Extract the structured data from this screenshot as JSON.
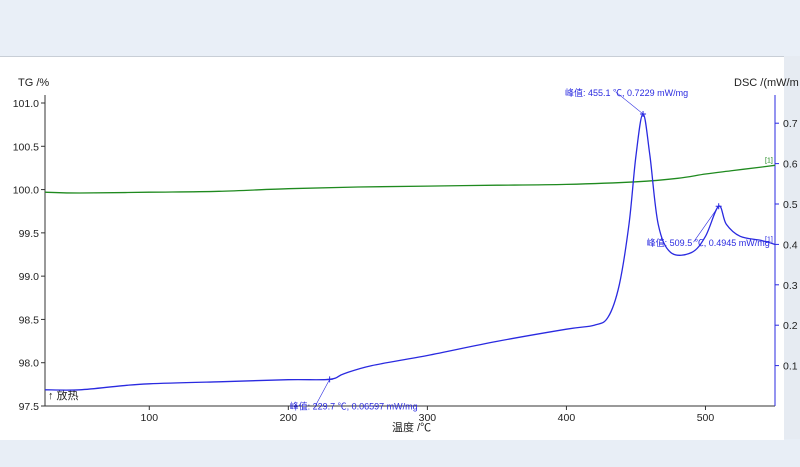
{
  "chart_data": {
    "type": "line",
    "y_left_label": "TG /%",
    "y_right_label": "DSC /(mW/m",
    "xlabel": "温度 /℃",
    "xlim": [
      25,
      550
    ],
    "x_ticks": [
      100,
      200,
      300,
      400,
      500
    ],
    "y_left_lim": [
      97.5,
      101.0
    ],
    "y_left_ticks": [
      "97.5",
      "98.0",
      "98.5",
      "99.0",
      "99.5",
      "100.0",
      "100.5",
      "101.0"
    ],
    "y_right_lim": [
      0.0,
      0.75
    ],
    "y_right_ticks": [
      "0.1",
      "0.2",
      "0.3",
      "0.4",
      "0.5",
      "0.6",
      "0.7"
    ],
    "exo_label": "↑ 放热",
    "series": [
      {
        "axis": "left",
        "color": "#1f8a1f",
        "end_marker": "[1]",
        "points": [
          [
            25,
            99.97
          ],
          [
            50,
            99.96
          ],
          [
            100,
            99.97
          ],
          [
            150,
            99.98
          ],
          [
            200,
            100.01
          ],
          [
            250,
            100.03
          ],
          [
            300,
            100.04
          ],
          [
            350,
            100.05
          ],
          [
            400,
            100.06
          ],
          [
            450,
            100.09
          ],
          [
            480,
            100.13
          ],
          [
            500,
            100.18
          ],
          [
            520,
            100.22
          ],
          [
            540,
            100.26
          ],
          [
            550,
            100.28
          ]
        ]
      },
      {
        "axis": "right",
        "color": "#2a2ae0",
        "end_marker": "[1]",
        "points": [
          [
            25,
            0.04
          ],
          [
            50,
            0.04
          ],
          [
            80,
            0.05
          ],
          [
            100,
            0.055
          ],
          [
            150,
            0.06
          ],
          [
            200,
            0.065
          ],
          [
            229.7,
            0.066
          ],
          [
            240,
            0.08
          ],
          [
            260,
            0.1
          ],
          [
            300,
            0.125
          ],
          [
            350,
            0.16
          ],
          [
            400,
            0.19
          ],
          [
            420,
            0.2
          ],
          [
            430,
            0.22
          ],
          [
            438,
            0.3
          ],
          [
            445,
            0.45
          ],
          [
            450,
            0.62
          ],
          [
            455.1,
            0.723
          ],
          [
            460,
            0.62
          ],
          [
            466,
            0.45
          ],
          [
            475,
            0.38
          ],
          [
            490,
            0.38
          ],
          [
            500,
            0.42
          ],
          [
            509.5,
            0.4945
          ],
          [
            515,
            0.45
          ],
          [
            525,
            0.42
          ],
          [
            540,
            0.41
          ],
          [
            550,
            0.4
          ]
        ]
      }
    ],
    "annotations": [
      {
        "text": "峰值: 455.1 ℃, 0.7229 mW/mg",
        "x": 455.1,
        "y": 0.7229
      },
      {
        "text": "峰值: 509.5 ℃, 0.4945 mW/mg",
        "x": 509.5,
        "y": 0.4945
      },
      {
        "text": "峰值: 229.7 ℃, 0.06597 mW/mg",
        "x": 229.7,
        "y": 0.06597
      }
    ]
  }
}
